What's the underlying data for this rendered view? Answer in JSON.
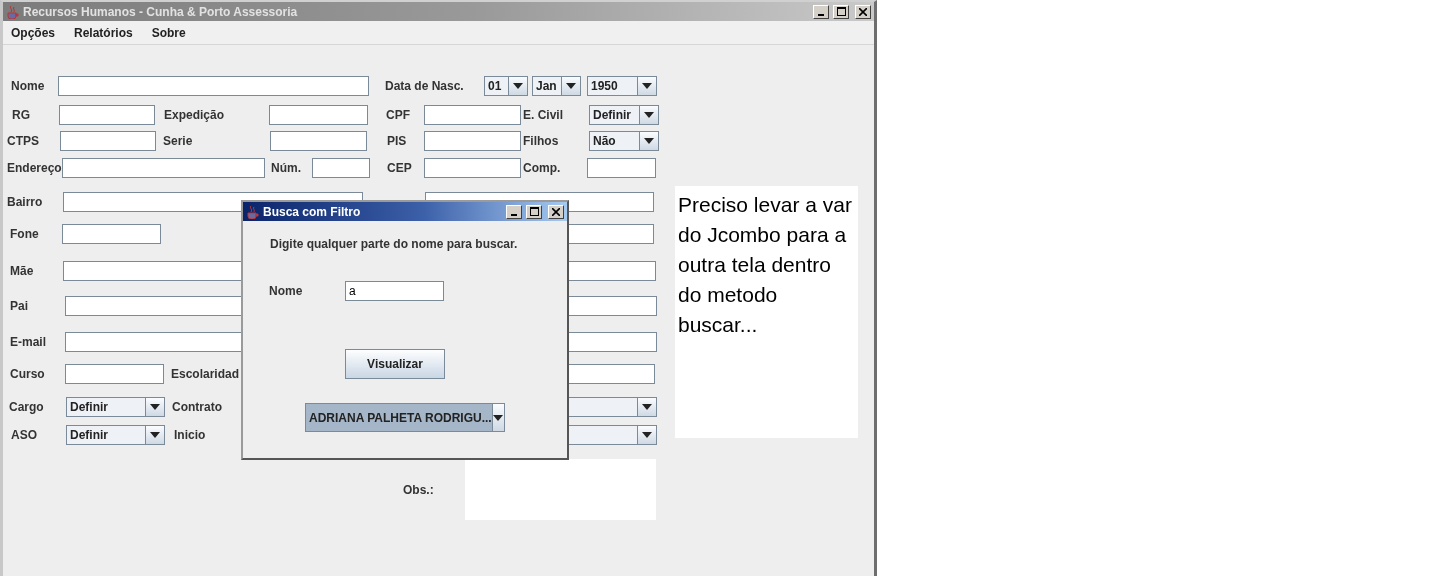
{
  "window": {
    "title": "Recursos Humanos - Cunha & Porto Assessoria",
    "active": false
  },
  "menu": [
    "Opções",
    "Relatórios",
    "Sobre"
  ],
  "form": {
    "rows": [
      {
        "items": [
          {
            "kind": "label",
            "text": "Nome"
          },
          {
            "kind": "field"
          },
          {
            "kind": "label",
            "text": "Data de Nasc."
          },
          {
            "kind": "combo",
            "value": "01"
          },
          {
            "kind": "combo",
            "value": "Jan"
          },
          {
            "kind": "combo",
            "value": "1950"
          }
        ]
      },
      {
        "items": [
          {
            "kind": "label",
            "text": "RG"
          },
          {
            "kind": "field"
          },
          {
            "kind": "label",
            "text": "Expedição"
          },
          {
            "kind": "field"
          },
          {
            "kind": "label",
            "text": "CPF"
          },
          {
            "kind": "field"
          },
          {
            "kind": "label",
            "text": "E. Civil"
          },
          {
            "kind": "combo",
            "value": "Definir"
          }
        ]
      },
      {
        "items": [
          {
            "kind": "label",
            "text": "CTPS"
          },
          {
            "kind": "field"
          },
          {
            "kind": "label",
            "text": "Serie"
          },
          {
            "kind": "field"
          },
          {
            "kind": "label",
            "text": "PIS"
          },
          {
            "kind": "field"
          },
          {
            "kind": "label",
            "text": "Filhos"
          },
          {
            "kind": "combo",
            "value": "Não"
          }
        ]
      },
      {
        "items": [
          {
            "kind": "label",
            "text": "Endereço"
          },
          {
            "kind": "field"
          },
          {
            "kind": "label",
            "text": "Núm."
          },
          {
            "kind": "field"
          },
          {
            "kind": "label",
            "text": "CEP"
          },
          {
            "kind": "field"
          },
          {
            "kind": "label",
            "text": "Comp."
          },
          {
            "kind": "field"
          }
        ]
      },
      {
        "items": [
          {
            "kind": "label",
            "text": "Bairro"
          },
          {
            "kind": "field"
          },
          {
            "kind": "field"
          }
        ]
      },
      {
        "items": [
          {
            "kind": "label",
            "text": "Fone"
          },
          {
            "kind": "field"
          },
          {
            "kind": "field"
          }
        ]
      },
      {
        "items": [
          {
            "kind": "label",
            "text": "Mãe"
          },
          {
            "kind": "field"
          },
          {
            "kind": "field"
          }
        ]
      },
      {
        "items": [
          {
            "kind": "label",
            "text": "Pai"
          },
          {
            "kind": "field"
          },
          {
            "kind": "field"
          }
        ]
      },
      {
        "items": [
          {
            "kind": "label",
            "text": "E-mail"
          },
          {
            "kind": "field"
          },
          {
            "kind": "field"
          }
        ]
      },
      {
        "items": [
          {
            "kind": "label",
            "text": "Curso"
          },
          {
            "kind": "field"
          },
          {
            "kind": "label",
            "text": "Escolaridad"
          },
          {
            "kind": "field"
          }
        ]
      },
      {
        "items": [
          {
            "kind": "label",
            "text": "Cargo"
          },
          {
            "kind": "combo",
            "value": "Definir"
          },
          {
            "kind": "label",
            "text": "Contrato"
          },
          {
            "kind": "combo"
          }
        ]
      },
      {
        "items": [
          {
            "kind": "label",
            "text": "ASO"
          },
          {
            "kind": "combo",
            "value": "Definir"
          },
          {
            "kind": "label",
            "text": "Inicio"
          },
          {
            "kind": "combo"
          }
        ]
      },
      {
        "items": [
          {
            "kind": "label",
            "text": "Obs.:"
          },
          {
            "kind": "textarea"
          }
        ]
      }
    ]
  },
  "note": "Preciso levar a var do Jcombo para a outra tela dentro do metodo buscar...",
  "dialog": {
    "title": "Busca com Filtro",
    "active": true,
    "prompt": "Digite qualquer parte do nome para buscar.",
    "name_label": "Nome",
    "name_value": "a",
    "button": "Visualizar",
    "result": "ADRIANA PALHETA RODRIGU..."
  }
}
